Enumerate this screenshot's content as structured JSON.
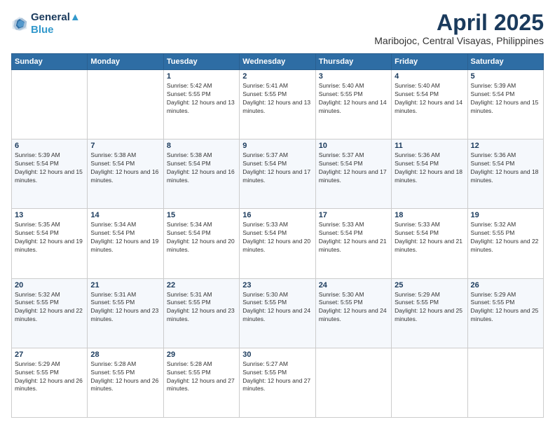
{
  "logo": {
    "line1": "General",
    "line2": "Blue"
  },
  "title": "April 2025",
  "location": "Maribojoc, Central Visayas, Philippines",
  "weekdays": [
    "Sunday",
    "Monday",
    "Tuesday",
    "Wednesday",
    "Thursday",
    "Friday",
    "Saturday"
  ],
  "weeks": [
    [
      {
        "day": "",
        "sunrise": "",
        "sunset": "",
        "daylight": ""
      },
      {
        "day": "",
        "sunrise": "",
        "sunset": "",
        "daylight": ""
      },
      {
        "day": "1",
        "sunrise": "Sunrise: 5:42 AM",
        "sunset": "Sunset: 5:55 PM",
        "daylight": "Daylight: 12 hours and 13 minutes."
      },
      {
        "day": "2",
        "sunrise": "Sunrise: 5:41 AM",
        "sunset": "Sunset: 5:55 PM",
        "daylight": "Daylight: 12 hours and 13 minutes."
      },
      {
        "day": "3",
        "sunrise": "Sunrise: 5:40 AM",
        "sunset": "Sunset: 5:55 PM",
        "daylight": "Daylight: 12 hours and 14 minutes."
      },
      {
        "day": "4",
        "sunrise": "Sunrise: 5:40 AM",
        "sunset": "Sunset: 5:54 PM",
        "daylight": "Daylight: 12 hours and 14 minutes."
      },
      {
        "day": "5",
        "sunrise": "Sunrise: 5:39 AM",
        "sunset": "Sunset: 5:54 PM",
        "daylight": "Daylight: 12 hours and 15 minutes."
      }
    ],
    [
      {
        "day": "6",
        "sunrise": "Sunrise: 5:39 AM",
        "sunset": "Sunset: 5:54 PM",
        "daylight": "Daylight: 12 hours and 15 minutes."
      },
      {
        "day": "7",
        "sunrise": "Sunrise: 5:38 AM",
        "sunset": "Sunset: 5:54 PM",
        "daylight": "Daylight: 12 hours and 16 minutes."
      },
      {
        "day": "8",
        "sunrise": "Sunrise: 5:38 AM",
        "sunset": "Sunset: 5:54 PM",
        "daylight": "Daylight: 12 hours and 16 minutes."
      },
      {
        "day": "9",
        "sunrise": "Sunrise: 5:37 AM",
        "sunset": "Sunset: 5:54 PM",
        "daylight": "Daylight: 12 hours and 17 minutes."
      },
      {
        "day": "10",
        "sunrise": "Sunrise: 5:37 AM",
        "sunset": "Sunset: 5:54 PM",
        "daylight": "Daylight: 12 hours and 17 minutes."
      },
      {
        "day": "11",
        "sunrise": "Sunrise: 5:36 AM",
        "sunset": "Sunset: 5:54 PM",
        "daylight": "Daylight: 12 hours and 18 minutes."
      },
      {
        "day": "12",
        "sunrise": "Sunrise: 5:36 AM",
        "sunset": "Sunset: 5:54 PM",
        "daylight": "Daylight: 12 hours and 18 minutes."
      }
    ],
    [
      {
        "day": "13",
        "sunrise": "Sunrise: 5:35 AM",
        "sunset": "Sunset: 5:54 PM",
        "daylight": "Daylight: 12 hours and 19 minutes."
      },
      {
        "day": "14",
        "sunrise": "Sunrise: 5:34 AM",
        "sunset": "Sunset: 5:54 PM",
        "daylight": "Daylight: 12 hours and 19 minutes."
      },
      {
        "day": "15",
        "sunrise": "Sunrise: 5:34 AM",
        "sunset": "Sunset: 5:54 PM",
        "daylight": "Daylight: 12 hours and 20 minutes."
      },
      {
        "day": "16",
        "sunrise": "Sunrise: 5:33 AM",
        "sunset": "Sunset: 5:54 PM",
        "daylight": "Daylight: 12 hours and 20 minutes."
      },
      {
        "day": "17",
        "sunrise": "Sunrise: 5:33 AM",
        "sunset": "Sunset: 5:54 PM",
        "daylight": "Daylight: 12 hours and 21 minutes."
      },
      {
        "day": "18",
        "sunrise": "Sunrise: 5:33 AM",
        "sunset": "Sunset: 5:54 PM",
        "daylight": "Daylight: 12 hours and 21 minutes."
      },
      {
        "day": "19",
        "sunrise": "Sunrise: 5:32 AM",
        "sunset": "Sunset: 5:55 PM",
        "daylight": "Daylight: 12 hours and 22 minutes."
      }
    ],
    [
      {
        "day": "20",
        "sunrise": "Sunrise: 5:32 AM",
        "sunset": "Sunset: 5:55 PM",
        "daylight": "Daylight: 12 hours and 22 minutes."
      },
      {
        "day": "21",
        "sunrise": "Sunrise: 5:31 AM",
        "sunset": "Sunset: 5:55 PM",
        "daylight": "Daylight: 12 hours and 23 minutes."
      },
      {
        "day": "22",
        "sunrise": "Sunrise: 5:31 AM",
        "sunset": "Sunset: 5:55 PM",
        "daylight": "Daylight: 12 hours and 23 minutes."
      },
      {
        "day": "23",
        "sunrise": "Sunrise: 5:30 AM",
        "sunset": "Sunset: 5:55 PM",
        "daylight": "Daylight: 12 hours and 24 minutes."
      },
      {
        "day": "24",
        "sunrise": "Sunrise: 5:30 AM",
        "sunset": "Sunset: 5:55 PM",
        "daylight": "Daylight: 12 hours and 24 minutes."
      },
      {
        "day": "25",
        "sunrise": "Sunrise: 5:29 AM",
        "sunset": "Sunset: 5:55 PM",
        "daylight": "Daylight: 12 hours and 25 minutes."
      },
      {
        "day": "26",
        "sunrise": "Sunrise: 5:29 AM",
        "sunset": "Sunset: 5:55 PM",
        "daylight": "Daylight: 12 hours and 25 minutes."
      }
    ],
    [
      {
        "day": "27",
        "sunrise": "Sunrise: 5:29 AM",
        "sunset": "Sunset: 5:55 PM",
        "daylight": "Daylight: 12 hours and 26 minutes."
      },
      {
        "day": "28",
        "sunrise": "Sunrise: 5:28 AM",
        "sunset": "Sunset: 5:55 PM",
        "daylight": "Daylight: 12 hours and 26 minutes."
      },
      {
        "day": "29",
        "sunrise": "Sunrise: 5:28 AM",
        "sunset": "Sunset: 5:55 PM",
        "daylight": "Daylight: 12 hours and 27 minutes."
      },
      {
        "day": "30",
        "sunrise": "Sunrise: 5:27 AM",
        "sunset": "Sunset: 5:55 PM",
        "daylight": "Daylight: 12 hours and 27 minutes."
      },
      {
        "day": "",
        "sunrise": "",
        "sunset": "",
        "daylight": ""
      },
      {
        "day": "",
        "sunrise": "",
        "sunset": "",
        "daylight": ""
      },
      {
        "day": "",
        "sunrise": "",
        "sunset": "",
        "daylight": ""
      }
    ]
  ]
}
